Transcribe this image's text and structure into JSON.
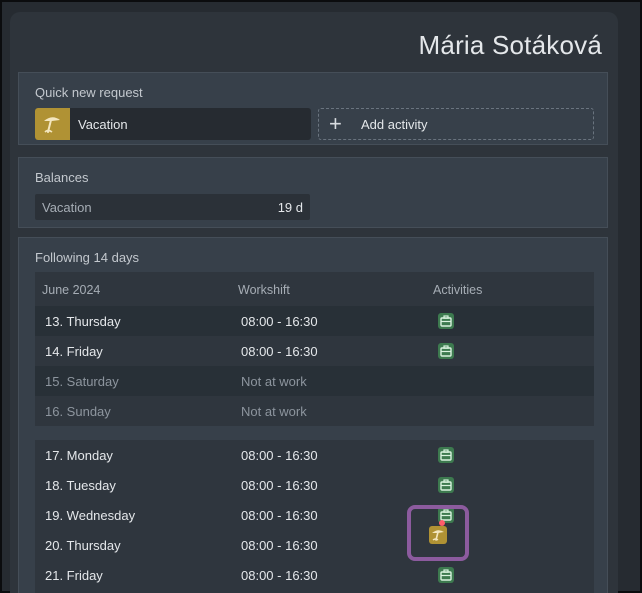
{
  "user": {
    "name": "Mária Sotáková"
  },
  "quick_request": {
    "title": "Quick new request",
    "vacation_label": "Vacation",
    "add_label": "Add activity"
  },
  "balances": {
    "title": "Balances",
    "items": [
      {
        "label": "Vacation",
        "value": "19 d"
      }
    ]
  },
  "following": {
    "title": "Following 14 days",
    "columns": {
      "month": "June 2024",
      "workshift": "Workshift",
      "activities": "Activities"
    },
    "week1": [
      {
        "day": "13. Thursday",
        "shift": "08:00 - 16:30",
        "activity": "work-briefcase-icon"
      },
      {
        "day": "14. Friday",
        "shift": "08:00 - 16:30",
        "activity": "work-briefcase-icon"
      },
      {
        "day": "15. Saturday",
        "shift": "Not at work",
        "activity": ""
      },
      {
        "day": "16. Sunday",
        "shift": "Not at work",
        "activity": ""
      }
    ],
    "week2": [
      {
        "day": "17. Monday",
        "shift": "08:00 - 16:30",
        "activity": "work-briefcase-icon"
      },
      {
        "day": "18. Tuesday",
        "shift": "08:00 - 16:30",
        "activity": "work-briefcase-icon"
      },
      {
        "day": "19. Wednesday",
        "shift": "08:00 - 16:30",
        "activity": "work-briefcase-icon"
      },
      {
        "day": "20. Thursday",
        "shift": "08:00 - 16:30",
        "activity": "vacation-umbrella-icon"
      },
      {
        "day": "21. Friday",
        "shift": "08:00 - 16:30",
        "activity": "work-briefcase-icon"
      }
    ]
  },
  "colors": {
    "accent_vacation": "#b09234",
    "work_icon": "#4fb36a",
    "highlight": "#8c5b9e",
    "notification_dot": "#ff5c6a"
  }
}
